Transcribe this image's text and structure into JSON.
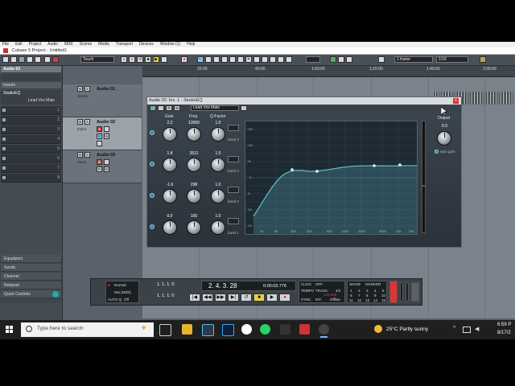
{
  "menubar": {
    "items": [
      "File",
      "Edit",
      "Project",
      "Audio",
      "MIDI",
      "Scores",
      "Media",
      "Transport",
      "Devices",
      "Window (1)",
      "Help"
    ]
  },
  "window": {
    "title": "Cubase 5 Project - Untitled1"
  },
  "toolbar": {
    "automation_mode": "Touch",
    "quantize": "1 frame",
    "snap": "1/16"
  },
  "ruler": {
    "ticks": [
      "20:00",
      "40:00",
      "1:00:00",
      "1:20:00",
      "1:40:00",
      "2:00:00"
    ]
  },
  "inspector": {
    "track_name": "Audio 02",
    "inserts_label": "Inserts",
    "insert_plugin": "StudioEQ",
    "insert_preset": "Lead Vox Male",
    "slot_numbers": [
      "1",
      "2",
      "3",
      "4",
      "5",
      "6",
      "7",
      "8"
    ],
    "lower_sections": [
      "Equalizers",
      "Sends",
      "Channel",
      "Notepad",
      "Quick Controls"
    ]
  },
  "tracks": [
    {
      "name": "Audio 01",
      "mode": "stereo"
    },
    {
      "name": "Audio 02",
      "mode": "mono"
    },
    {
      "name": "Audio 03",
      "mode": "mono"
    }
  ],
  "eq": {
    "window_title": "Audio 02: Ins. 1 - StudioEQ",
    "preset": "Lead Vox Male",
    "close_label": "x",
    "col_gain": "Gain",
    "col_freq": "Freq",
    "col_q": "Q-Factor",
    "bands": [
      {
        "gain": "2.2",
        "freq": "10000",
        "q": "1.0",
        "label": "band 4"
      },
      {
        "gain": "1.8",
        "freq": "3511",
        "q": "1.0",
        "label": "band 3"
      },
      {
        "gain": "-1.6",
        "freq": "298",
        "q": "1.0",
        "label": "band 2"
      },
      {
        "gain": "0.0",
        "freq": "100",
        "q": "1.0",
        "label": "band 1"
      }
    ],
    "output_label": "Output",
    "output_value": "0.0",
    "auto_gain": "auto gain",
    "db_scale": [
      "+24",
      "+20",
      "+16",
      "+12",
      "+8",
      "+4",
      "0",
      "-4",
      "-8",
      "-12",
      "-16",
      "-20",
      "-24"
    ],
    "freq_scale": [
      "20",
      "50",
      "100",
      "200",
      "500",
      "1000",
      "2000",
      "5000",
      "10k",
      "20k"
    ],
    "meter_inf": "-oo"
  },
  "transport": {
    "modes": [
      "Normal",
      "Mix (MIDI)"
    ],
    "auto_q": "AUTO Q",
    "off_label": "Off",
    "locator_left": "1. 1. 1. 0",
    "locator_right": "1. 1. 1. 0",
    "position_bars": "2. 4. 3. 28",
    "position_time": "0:00:03.776",
    "click": "CLICK",
    "click_val": "OFF",
    "tempo": "TEMPO",
    "tempo_mode": "TRACK",
    "signature": "4/4",
    "tempo_val": "120.000",
    "sync": "SYNC",
    "sync_int": "INT.",
    "sync_off": "Offline",
    "show": "SHOW",
    "marker": "MARKER",
    "marker_nums": [
      "1",
      "2",
      "3",
      "4",
      "5",
      "6",
      "7",
      "8",
      "9",
      "10",
      "11",
      "12",
      "13",
      "14",
      "15"
    ]
  },
  "taskbar": {
    "search_placeholder": "Type here to search",
    "weather": "25°C  Partly sunny",
    "time": "6:59 P",
    "date": "8/17/2"
  },
  "colors": {
    "eq_curve": "#5fb9c7",
    "rec_red": "#d03030",
    "windows_blue": "#2d7ae5"
  }
}
